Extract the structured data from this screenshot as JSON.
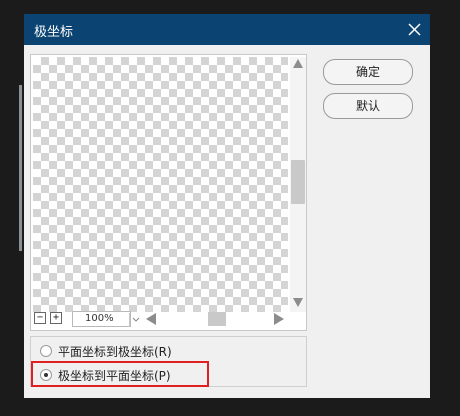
{
  "dialog": {
    "title": "极坐标",
    "close_icon": "close-icon"
  },
  "preview": {
    "zoom_value": "100%",
    "zoom_out_label": "−",
    "zoom_in_label": "+"
  },
  "buttons": {
    "ok_label": "确定",
    "default_label": "默认"
  },
  "options": {
    "rect_to_polar": "平面坐标到极坐标(R)",
    "polar_to_rect": "极坐标到平面坐标(P)",
    "selected": "polar_to_rect"
  },
  "colors": {
    "titlebar": "#0b4472",
    "highlight": "#e02020"
  }
}
